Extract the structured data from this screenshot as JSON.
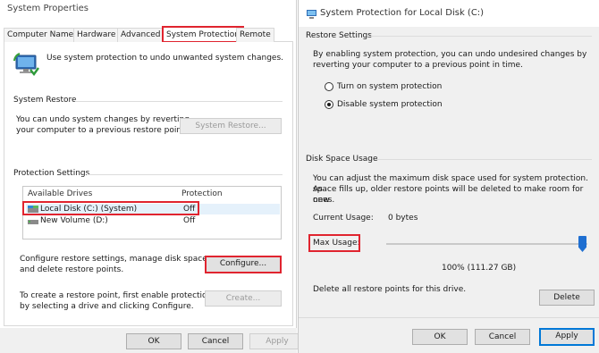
{
  "left_window": {
    "title": "System Properties",
    "tabs": [
      "Computer Name",
      "Hardware",
      "Advanced",
      "System Protection",
      "Remote"
    ],
    "intro_text": "Use system protection to undo unwanted system changes.",
    "system_restore": {
      "heading": "System Restore",
      "description_line1": "You can undo system changes by reverting",
      "description_line2": "your computer to a previous restore point.",
      "button": "System Restore..."
    },
    "protection_settings": {
      "heading": "Protection Settings",
      "columns": [
        "Available Drives",
        "Protection"
      ],
      "drives": [
        {
          "name": "Local Disk (C:) (System)",
          "protection": "Off"
        },
        {
          "name": "New Volume (D:)",
          "protection": "Off"
        }
      ],
      "configure_text_line1": "Configure restore settings, manage disk space,",
      "configure_text_line2": "and delete restore points.",
      "configure_button": "Configure...",
      "create_text_line1": "To create a restore point, first enable protection",
      "create_text_line2": "by selecting a drive and clicking Configure.",
      "create_button": "Create..."
    },
    "footer": {
      "ok": "OK",
      "cancel": "Cancel",
      "apply": "Apply"
    }
  },
  "right_window": {
    "title": "System Protection for Local Disk (C:)",
    "restore_settings": {
      "heading": "Restore Settings",
      "description_line1": "By enabling system protection, you can undo undesired changes by",
      "description_line2": "reverting your computer to a previous point in time.",
      "option_on": "Turn on system protection",
      "option_off": "Disable system protection",
      "selected": "Disable system protection"
    },
    "disk_space": {
      "heading": "Disk Space Usage",
      "description_line1": "You can adjust the maximum disk space used for system protection. As",
      "description_line2": "space fills up, older restore points will be deleted to make room for new",
      "description_line3": "ones.",
      "current_usage_label": "Current Usage:",
      "current_usage_value": "0 bytes",
      "max_usage_label": "Max Usage:",
      "max_usage_value_text": "100% (111.27 GB)",
      "max_usage_percent": 100,
      "delete_text": "Delete all restore points for this drive.",
      "delete_button": "Delete"
    },
    "footer": {
      "ok": "OK",
      "cancel": "Cancel",
      "apply": "Apply"
    }
  },
  "colors": {
    "highlight": "#e0242f",
    "slider": "#1f6fd1",
    "selection": "#e5f1fb"
  }
}
